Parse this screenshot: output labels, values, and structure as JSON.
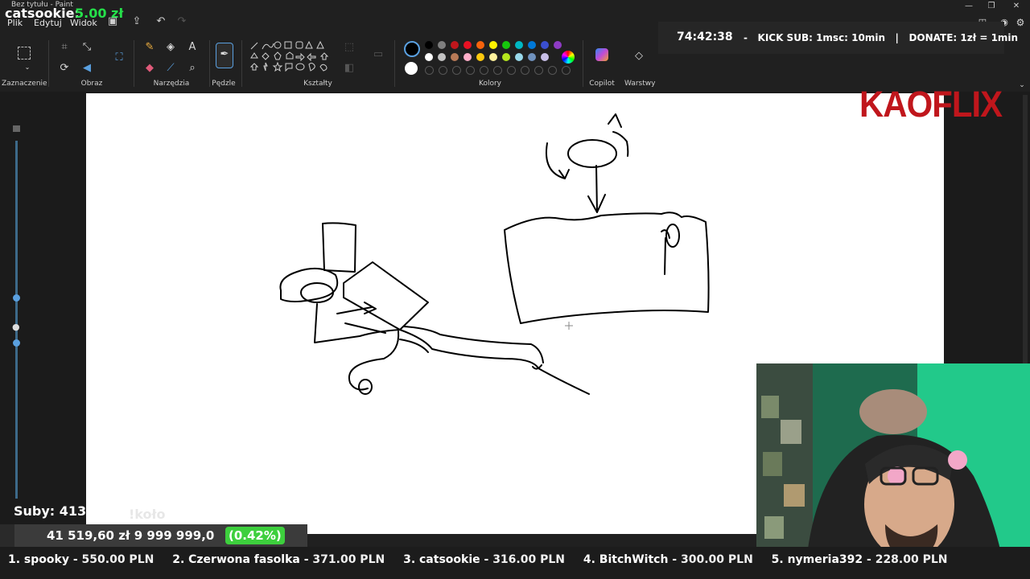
{
  "window": {
    "title": "Bez tytułu - Paint",
    "menu": [
      "Plik",
      "Edytuj",
      "Widok"
    ]
  },
  "donation_alert": {
    "name": "catsookie:",
    "amount": "5.00 zł"
  },
  "ribbon": {
    "groups": {
      "selection": "Zaznaczenie",
      "image": "Obraz",
      "tools": "Narzędzia",
      "brushes": "Pędzle",
      "shapes": "Kształty",
      "colors": "Kolory",
      "copilot": "Copilot",
      "layers": "Warstwy"
    },
    "palette_row1": [
      "#000000",
      "#7f7f7f",
      "#c0161c",
      "#e81123",
      "#f7630c",
      "#fff100",
      "#16c60c",
      "#00b7c3",
      "#0078d7",
      "#3a4fcf",
      "#8e3bc4"
    ],
    "palette_row2": [
      "#ffffff",
      "#c3c3c3",
      "#b97a57",
      "#ffaec9",
      "#ffc90e",
      "#fff29c",
      "#b5e61d",
      "#99d9ea",
      "#7092be",
      "#c8bfe7"
    ],
    "primary_color": "#000000",
    "secondary_color": "#ffffff"
  },
  "stream_overlay": {
    "timer": "74:42:38",
    "info": "-   KICK SUB: 1msc: 10min   |   DONATE: 1zł = 1min",
    "brand": "KAOFLIX",
    "subs": "Suby: 4138/50",
    "subs_faded": "!koło",
    "goal": "41 519,60 zł  9 999 999,0",
    "goal_pct": "(0.42%)",
    "ticker": [
      {
        "label": "1. spooky - ",
        "amount": "550.00 PLN"
      },
      {
        "label": "2. Czerwona fasolka - ",
        "amount": "371.00 PLN"
      },
      {
        "label": "3. catsookie - ",
        "amount": "316.00 PLN"
      },
      {
        "label": "4. BitchWitch - ",
        "amount": "300.00 PLN"
      },
      {
        "label": "5. nymeria392 - ",
        "amount": "228.00 PLN"
      }
    ]
  }
}
